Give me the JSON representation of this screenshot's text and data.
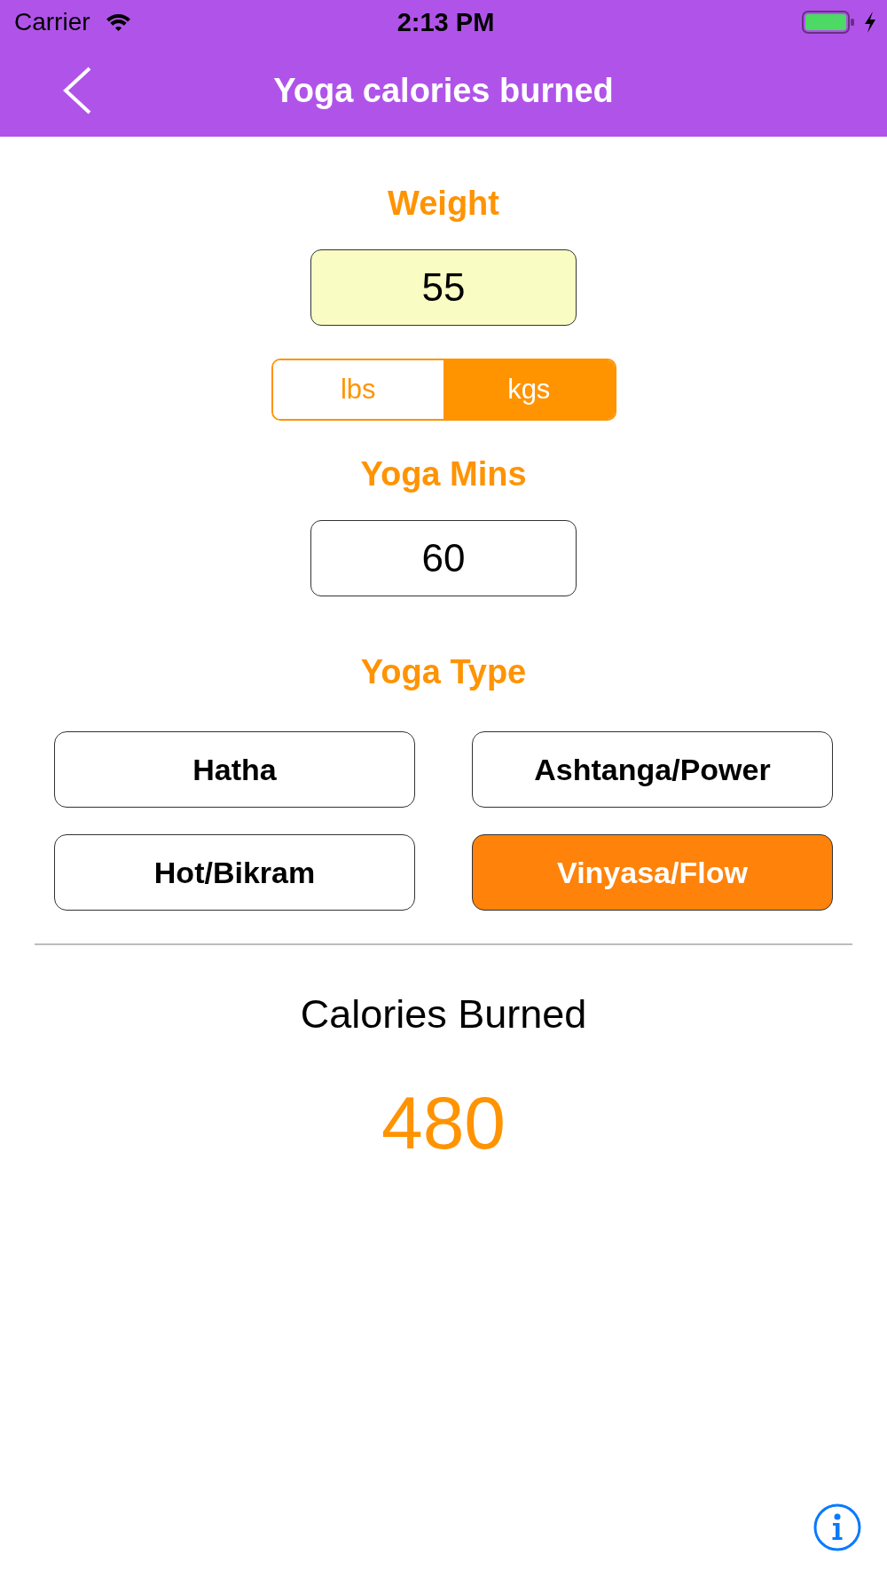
{
  "status_bar": {
    "carrier": "Carrier",
    "time": "2:13 PM"
  },
  "nav_bar": {
    "title": "Yoga calories burned"
  },
  "weight": {
    "label": "Weight",
    "value": "55",
    "highlighted": true
  },
  "units": [
    {
      "label": "lbs",
      "selected": false
    },
    {
      "label": "kgs",
      "selected": true
    }
  ],
  "minutes": {
    "label": "Yoga Mins",
    "value": "60",
    "highlighted": false
  },
  "yoga_type": {
    "label": "Yoga Type",
    "options": [
      {
        "label": "Hatha",
        "selected": false
      },
      {
        "label": "Ashtanga/Power",
        "selected": false
      },
      {
        "label": "Hot/Bikram",
        "selected": false
      },
      {
        "label": "Vinyasa/Flow",
        "selected": true
      }
    ]
  },
  "result": {
    "label": "Calories Burned",
    "value": "480"
  }
}
